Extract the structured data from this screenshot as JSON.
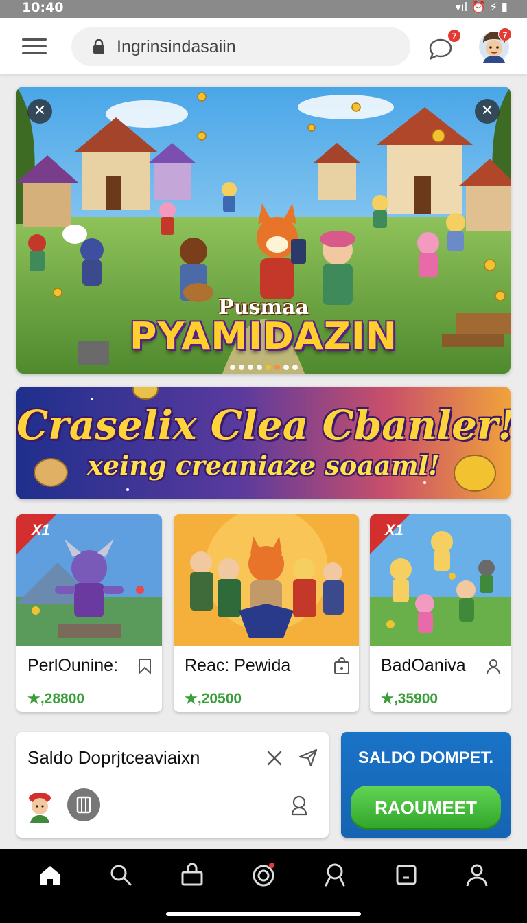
{
  "status_bar": {
    "time": "10:40",
    "icons": "▾ıl ⏰ ⚡ ▮"
  },
  "header": {
    "search_text": "Ingrinsindasaiin",
    "chat_badge": "7",
    "avatar_badge": "7"
  },
  "hero": {
    "subtitle": "Pusmaa",
    "title": "PYAMIDAZIN",
    "slide_count": 8,
    "active_slide": 4
  },
  "promo": {
    "title": "Craselix Clea Cbanler!",
    "subtitle": "xeing creaniaze soaaml!"
  },
  "cards": [
    {
      "title": "PerlOunine:",
      "price": "★,28800",
      "ribbon": "X1",
      "icon": "bookmark-icon"
    },
    {
      "title": "Reac: Pewida",
      "price": "★,20500",
      "ribbon": "",
      "icon": "bag-icon"
    },
    {
      "title": "BadOaniva",
      "price": "★,35900",
      "ribbon": "X1",
      "icon": "user-icon"
    }
  ],
  "wallet": {
    "title": "Saldo Doprjtceaviaixn"
  },
  "wallet_cta": {
    "title": "SALDO DOMPET.",
    "button": "RAOUMEET"
  },
  "bottom_nav": [
    "home-icon",
    "search-icon",
    "bag-icon",
    "target-icon",
    "award-icon",
    "square-icon",
    "profile-icon"
  ],
  "colors": {
    "ribbon": "#d32f2f",
    "price": "#3a9e3a",
    "cta_button": "#2fa52a",
    "cta_bg": "#1a73c7",
    "badge": "#e53935"
  }
}
